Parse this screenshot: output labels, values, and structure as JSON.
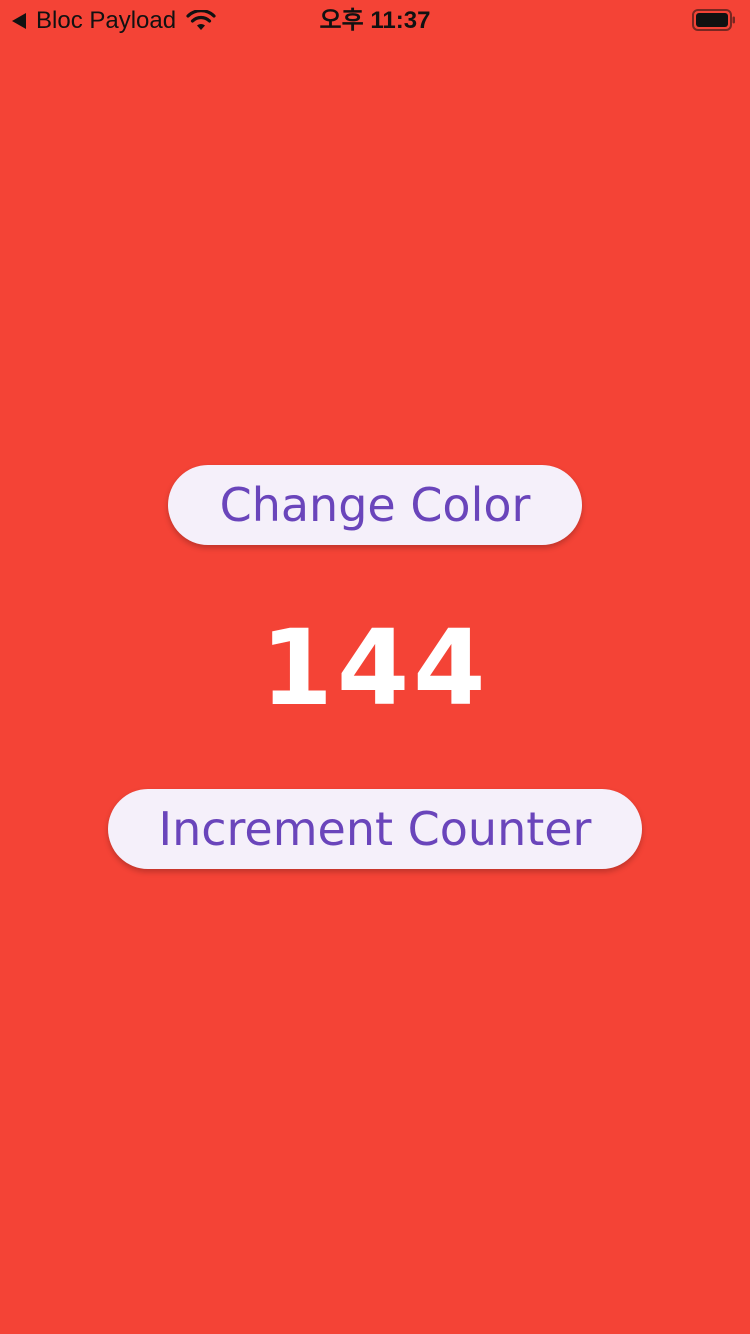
{
  "status_bar": {
    "back_app_label": "Bloc Payload",
    "time": "오후 11:37"
  },
  "main": {
    "change_color_label": "Change Color",
    "counter_value": "144",
    "increment_label": "Increment Counter"
  },
  "colors": {
    "background": "#F44336",
    "button_background": "#F5F0FA",
    "button_text": "#6A45BB",
    "counter_text": "#FFFFFF"
  },
  "icons": {
    "back": "back-arrow-icon",
    "wifi": "wifi-icon",
    "battery": "battery-icon"
  }
}
